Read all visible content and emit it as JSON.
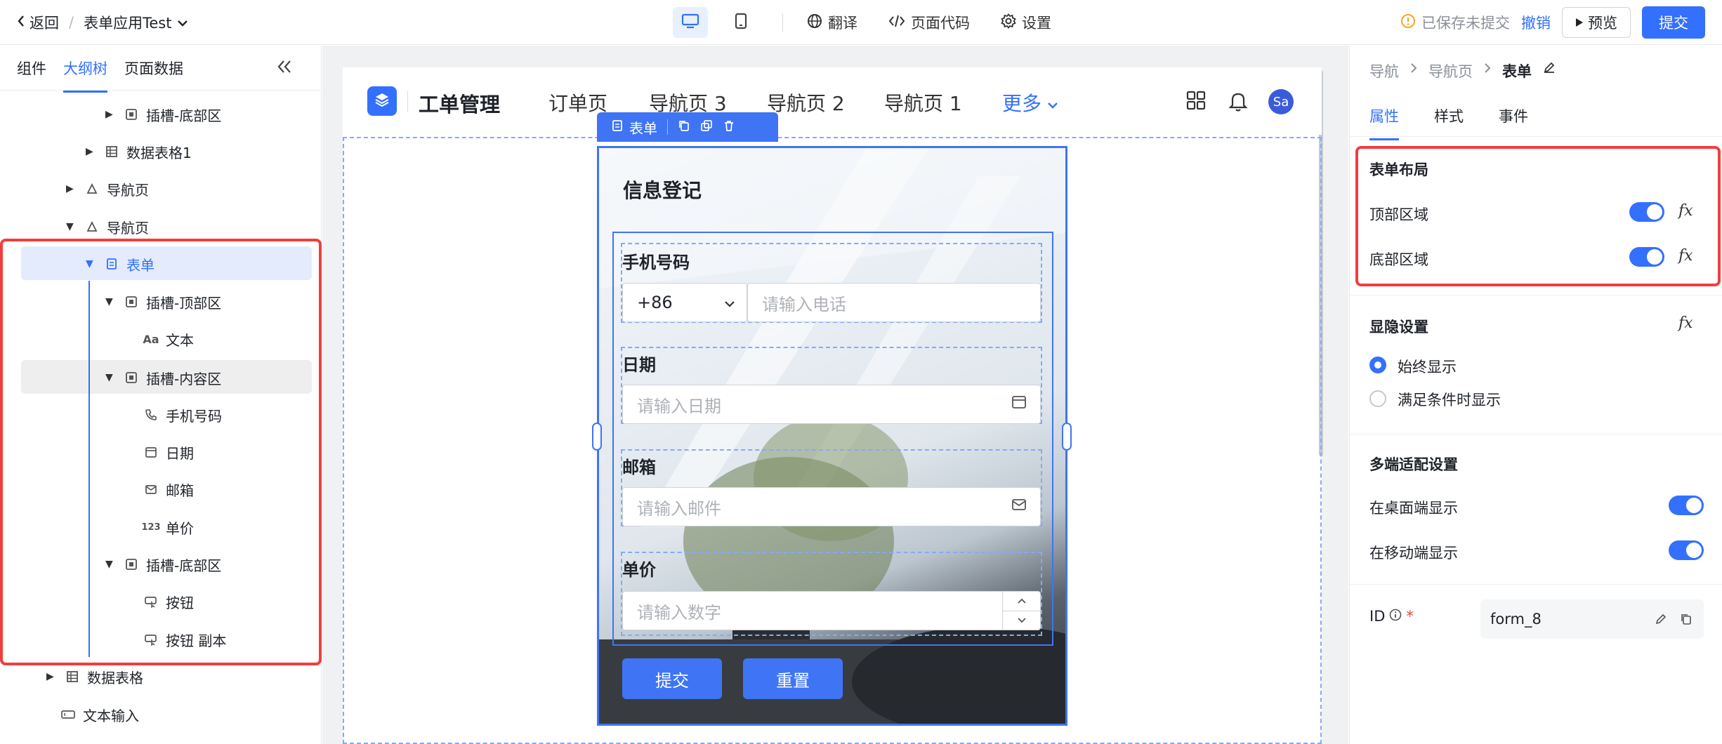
{
  "topbar": {
    "back_label": "返回",
    "app_name": "表单应用Test",
    "translate_label": "翻译",
    "code_label": "页面代码",
    "settings_label": "设置",
    "saved_status": "已保存未提交",
    "undo_label": "撤销",
    "preview_label": "预览",
    "submit_label": "提交"
  },
  "left_panel": {
    "tabs": [
      "组件",
      "大纲树",
      "页面数据"
    ],
    "active_tab": "大纲树",
    "tree": [
      {
        "label": "插槽-底部区"
      },
      {
        "label": "数据表格1"
      },
      {
        "label": "导航页"
      },
      {
        "label": "导航页"
      },
      {
        "label": "表单"
      },
      {
        "label": "插槽-顶部区"
      },
      {
        "label": "文本"
      },
      {
        "label": "插槽-内容区"
      },
      {
        "label": "手机号码"
      },
      {
        "label": "日期"
      },
      {
        "label": "邮箱"
      },
      {
        "label": "单价"
      },
      {
        "label": "插槽-底部区"
      },
      {
        "label": "按钮"
      },
      {
        "label": "按钮 副本"
      },
      {
        "label": "数据表格"
      },
      {
        "label": "文本输入"
      }
    ]
  },
  "canvas": {
    "app_title": "工单管理",
    "nav_items": [
      "订单页",
      "导航页 3",
      "导航页 2",
      "导航页 1"
    ],
    "nav_more": "更多",
    "avatar_text": "Sa",
    "toolbar_label": "表单",
    "form": {
      "title": "信息登记",
      "phone_label": "手机号码",
      "country_code": "+86",
      "phone_placeholder": "请输入电话",
      "date_label": "日期",
      "date_placeholder": "请输入日期",
      "email_label": "邮箱",
      "email_placeholder": "请输入邮件",
      "price_label": "单价",
      "price_placeholder": "请输入数字",
      "submit_label": "提交",
      "reset_label": "重置"
    }
  },
  "right_panel": {
    "breadcrumb": [
      "导航",
      "导航页",
      "表单"
    ],
    "tabs": [
      "属性",
      "样式",
      "事件"
    ],
    "active_tab": "属性",
    "layout_section": "表单布局",
    "top_area_label": "顶部区域",
    "bottom_area_label": "底部区域",
    "visibility_section": "显隐设置",
    "visibility_options": [
      "始终显示",
      "满足条件时显示"
    ],
    "multi_section": "多端适配设置",
    "desktop_label": "在桌面端显示",
    "mobile_label": "在移动端显示",
    "id_label": "ID",
    "id_value": "form_8",
    "fx_symbol": "fx"
  },
  "colors": {
    "accent": "#3370ff",
    "highlight_red": "#f23d3d",
    "warning": "#f5a623"
  }
}
